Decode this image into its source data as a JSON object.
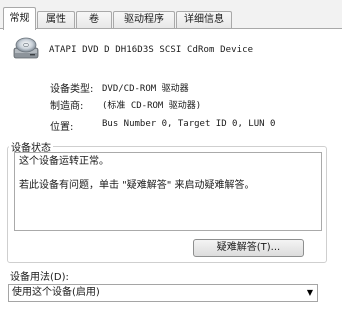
{
  "tabs": [
    {
      "label": "常规",
      "active": true
    },
    {
      "label": "属性",
      "active": false
    },
    {
      "label": "卷",
      "active": false
    },
    {
      "label": "驱动程序",
      "active": false
    },
    {
      "label": "详细信息",
      "active": false
    }
  ],
  "device": {
    "name": "ATAPI DVD D  DH16D3S SCSI CdRom Device",
    "icon": "dvd-drive-icon"
  },
  "properties": {
    "type_label": "设备类型:",
    "type_value": "DVD/CD-ROM 驱动器",
    "manufacturer_label": "制造商:",
    "manufacturer_value": "(标准 CD-ROM 驱动器)",
    "location_label": "位置:",
    "location_value": "Bus Number 0, Target ID 0, LUN 0"
  },
  "status": {
    "group_title": "设备状态",
    "line1": "这个设备运转正常。",
    "line2": "若此设备有问题，单击 \"疑难解答\" 来启动疑难解答。",
    "troubleshoot_button": "疑难解答(T)..."
  },
  "usage": {
    "label": "设备用法(D):",
    "selected": "使用这个设备(启用)"
  }
}
